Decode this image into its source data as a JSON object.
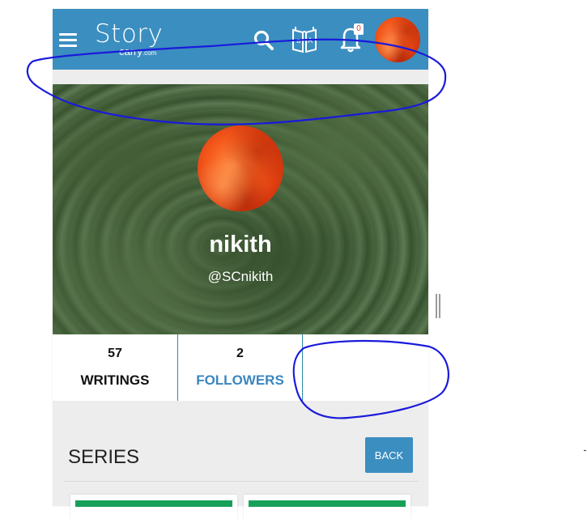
{
  "header": {
    "logo_text": "Story",
    "logo_sub": "carry",
    "logo_domain": ".com",
    "notification_count": "0",
    "icons": [
      "menu-icon",
      "search-icon",
      "book-translate-icon",
      "bell-icon",
      "avatar"
    ],
    "bar_color": "#3b8ec0"
  },
  "profile": {
    "name": "nikith",
    "handle": "@SCnikith"
  },
  "stats": [
    {
      "count": "57",
      "label": "WRITINGS"
    },
    {
      "count": "2",
      "label": "FOLLOWERS"
    }
  ],
  "series": {
    "title": "SERIES",
    "back_label": "BACK"
  },
  "colors": {
    "accent": "#3b8ec0",
    "card_bar": "#18a05a",
    "annotation": "#1a1adc"
  }
}
